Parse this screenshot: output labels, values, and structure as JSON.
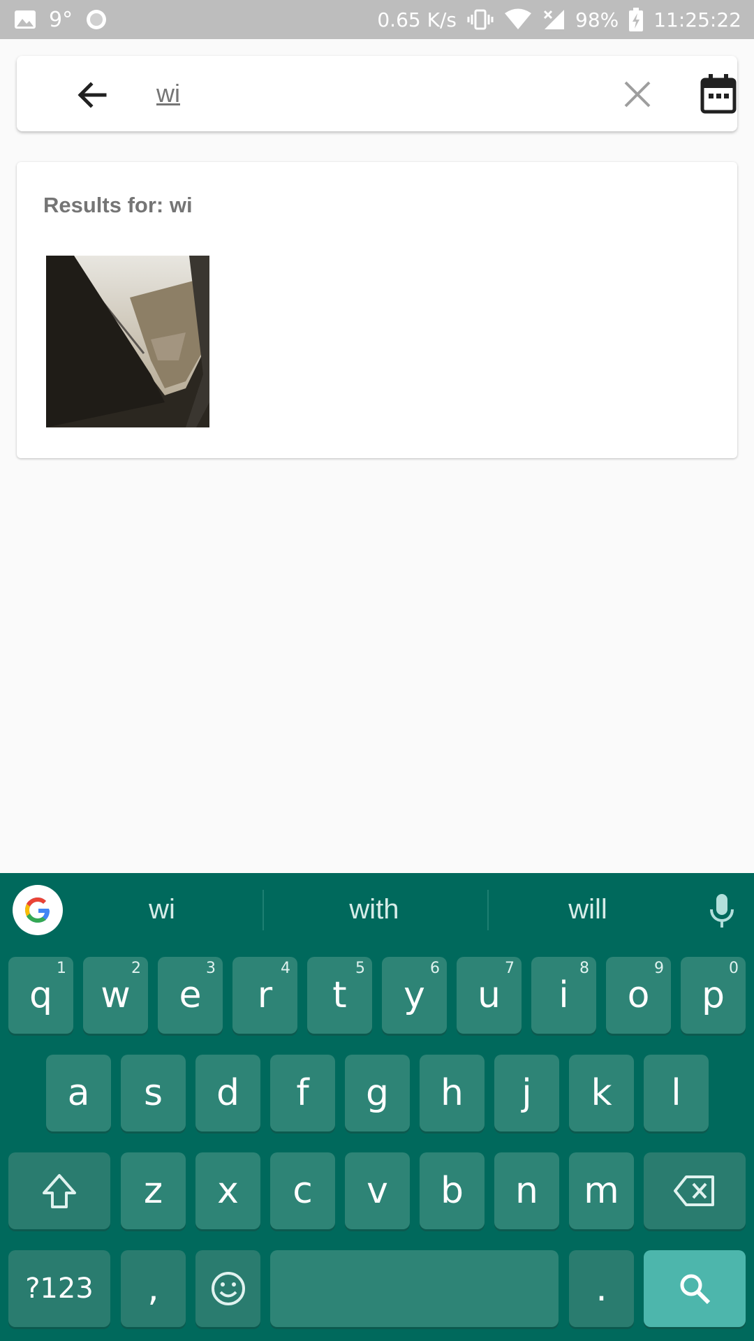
{
  "status_bar": {
    "temperature": "9°",
    "network_speed": "0.65 K/s",
    "battery": "98%",
    "time": "11:25:22"
  },
  "search": {
    "query": "wi"
  },
  "results": {
    "title": "Results for: wi"
  },
  "keyboard": {
    "suggestions": [
      "wi",
      "with",
      "will"
    ],
    "row1": [
      {
        "key": "q",
        "hint": "1"
      },
      {
        "key": "w",
        "hint": "2"
      },
      {
        "key": "e",
        "hint": "3"
      },
      {
        "key": "r",
        "hint": "4"
      },
      {
        "key": "t",
        "hint": "5"
      },
      {
        "key": "y",
        "hint": "6"
      },
      {
        "key": "u",
        "hint": "7"
      },
      {
        "key": "i",
        "hint": "8"
      },
      {
        "key": "o",
        "hint": "9"
      },
      {
        "key": "p",
        "hint": "0"
      }
    ],
    "row2": [
      "a",
      "s",
      "d",
      "f",
      "g",
      "h",
      "j",
      "k",
      "l"
    ],
    "row3": [
      "z",
      "x",
      "c",
      "v",
      "b",
      "n",
      "m"
    ],
    "symbols_label": "?123",
    "comma": ",",
    "period": ".",
    "colors": {
      "background": "#00695c",
      "key": "#2e8476",
      "action_key": "#4db6ac"
    }
  }
}
